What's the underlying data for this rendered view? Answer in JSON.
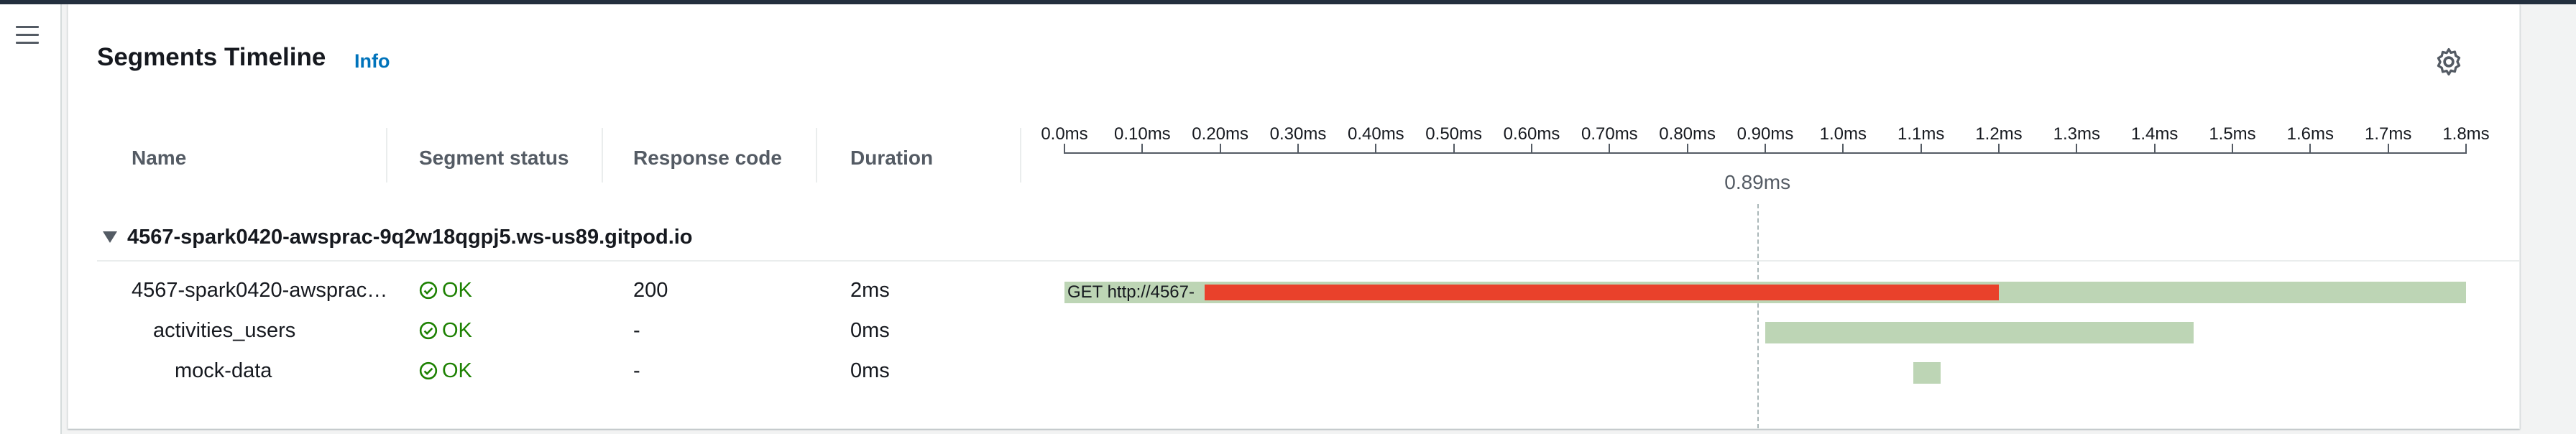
{
  "panel": {
    "title": "Segments Timeline",
    "info_label": "Info"
  },
  "columns": [
    "Name",
    "Segment status",
    "Response code",
    "Duration"
  ],
  "timeline": {
    "ticks": [
      "0.0ms",
      "0.10ms",
      "0.20ms",
      "0.30ms",
      "0.40ms",
      "0.50ms",
      "0.60ms",
      "0.70ms",
      "0.80ms",
      "0.90ms",
      "1.0ms",
      "1.1ms",
      "1.2ms",
      "1.3ms",
      "1.4ms",
      "1.5ms",
      "1.6ms",
      "1.7ms",
      "1.8ms"
    ],
    "cursor_label": "0.89ms",
    "cursor_ms": 0.89,
    "max_ms": 1.8
  },
  "group": {
    "name": "4567-spark0420-awsprac-9q2w18qgpj5.ws-us89.gitpod.io"
  },
  "rows": [
    {
      "name": "4567-spark0420-awsprac…",
      "status": "OK",
      "response_code": "200",
      "duration": "2ms",
      "bar_label": "GET http://4567-",
      "bar_start_ms": 0.0,
      "bar_end_ms": 1.8,
      "fault_start_ms": 0.18,
      "fault_end_ms": 1.2
    },
    {
      "name": "activities_users",
      "status": "OK",
      "response_code": "-",
      "duration": "0ms",
      "bar_start_ms": 0.9,
      "bar_end_ms": 1.45
    },
    {
      "name": "mock-data",
      "status": "OK",
      "response_code": "-",
      "duration": "0ms",
      "bar_start_ms": 1.09,
      "bar_end_ms": 1.125
    }
  ],
  "colors": {
    "bar": "#bdd5b5",
    "fault": "#e9412b",
    "ok": "#1d8102",
    "link": "#0073bb"
  }
}
